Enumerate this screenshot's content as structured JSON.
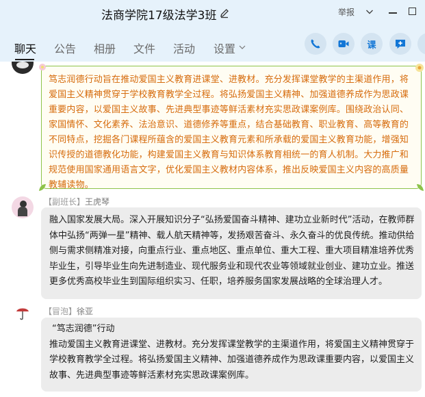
{
  "window": {
    "title": "法商学院17级法学3班",
    "report_label": "举报"
  },
  "tabs": [
    {
      "label": "聊天"
    },
    {
      "label": "公告"
    },
    {
      "label": "相册"
    },
    {
      "label": "文件"
    },
    {
      "label": "活动"
    },
    {
      "label": "设置"
    }
  ],
  "actions": {
    "course_label": "课"
  },
  "colors": {
    "accent": "#1276d6",
    "notice_text": "#d66b0c",
    "notice_border": "#8dc34a"
  },
  "messages": [
    {
      "text": "笃志润德行动旨在推动爱国主义教育进课堂、进教材。充分发挥课堂教学的主渠道作用，将爱国主义精神贯穿于学校教育教学全过程。将弘扬爱国主义精神、加强道德养成作为思政课重要内容，以爱国主义故事、先进典型事迹等鲜活素材充实思政课案例库。围绕政治认同、家国情怀、文化素养、法治意识、道德修养等重点，结合基础教育、职业教育、高等教育的不同特点，挖掘各门课程所蕴含的爱国主义教育元素和所承载的爱国主义教育功能，增强知识传授的道德教化功能，构建爱国主义教育与知识体系教育相统一的育人机制。大力推广和规范使用国家通用语言文字，优化爱国主义教材内容体系，推出反映爱国主义内容的高质量教辅读物。"
    },
    {
      "role": "【副班长】",
      "name": "王虎琴",
      "text": "融入国家发展大局。深入开展知识分子“弘扬爱国奋斗精神、建功立业新时代”活动，在教师群体中弘扬“两弹一星”精神、载人航天精神等，发扬艰苦奋斗、永久奋斗的优良传统。推动供给侧与需求侧精准对接，向重点行业、重点地区、重点单位、重大工程、重大项目精准培养优秀毕业生，引导毕业生向先进制造业、现代服务业和现代农业等领域就业创业、建功立业。推送更多优秀高校毕业生到国际组织实习、任职，培养服务国家发展战略的全球治理人才。"
    },
    {
      "role": "【冒泡】",
      "name": "徐亚",
      "heading": "“笃志润德”行动",
      "text": "推动爱国主义教育进课堂、进教材。充分发挥课堂教学的主渠道作用，将爱国主义精神贯穿于学校教育教学全过程。将弘扬爱国主义精神、加强道德养成作为思政课重要内容，以爱国主义故事、先进典型事迹等鲜活素材充实思政课案例库。"
    }
  ]
}
